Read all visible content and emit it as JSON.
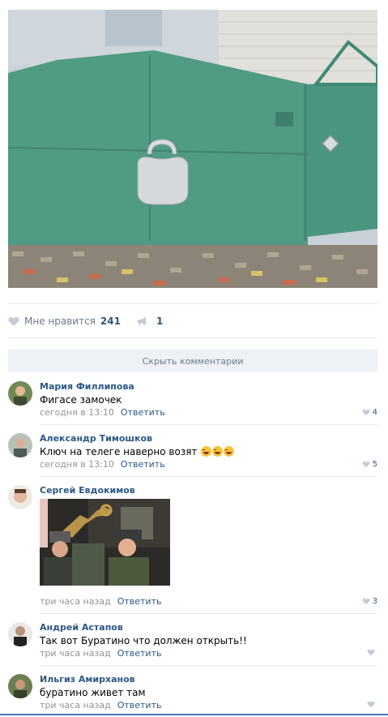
{
  "post": {
    "photo_alt": "photo-gate-with-padlock",
    "likes_label": "Мне нравится",
    "likes_count": "241",
    "shares_count": "1"
  },
  "comments_section": {
    "hide_label": "Скрыть комментарии"
  },
  "comments": [
    {
      "author": "Мария Филлипова",
      "text": "Фигасе замочек",
      "time": "сегодня в 13:10",
      "reply": "Ответить",
      "likes": "4"
    },
    {
      "author": "Александр Тимошков",
      "text": "Ключ на телеге наверно возят",
      "time": "сегодня в 13:10",
      "reply": "Ответить",
      "likes": "5"
    },
    {
      "author": "Сергей Евдокимов",
      "text": "",
      "time": "три часа назад",
      "reply": "Ответить",
      "likes": "3"
    },
    {
      "author": "Андрей Астапов",
      "text": "Так вот Буратино что должен открыть!!",
      "time": "три часа назад",
      "reply": "Ответить",
      "likes": ""
    },
    {
      "author": "Ильгиз Амирханов",
      "text": "буратино живет там",
      "time": "три часа назад",
      "reply": "Ответить",
      "likes": ""
    }
  ],
  "colors": {
    "link": "#2a5885",
    "muted": "#939393",
    "divider": "#e7e8ec",
    "button_bg": "#eef1f5",
    "gate": "#4f9b84"
  }
}
